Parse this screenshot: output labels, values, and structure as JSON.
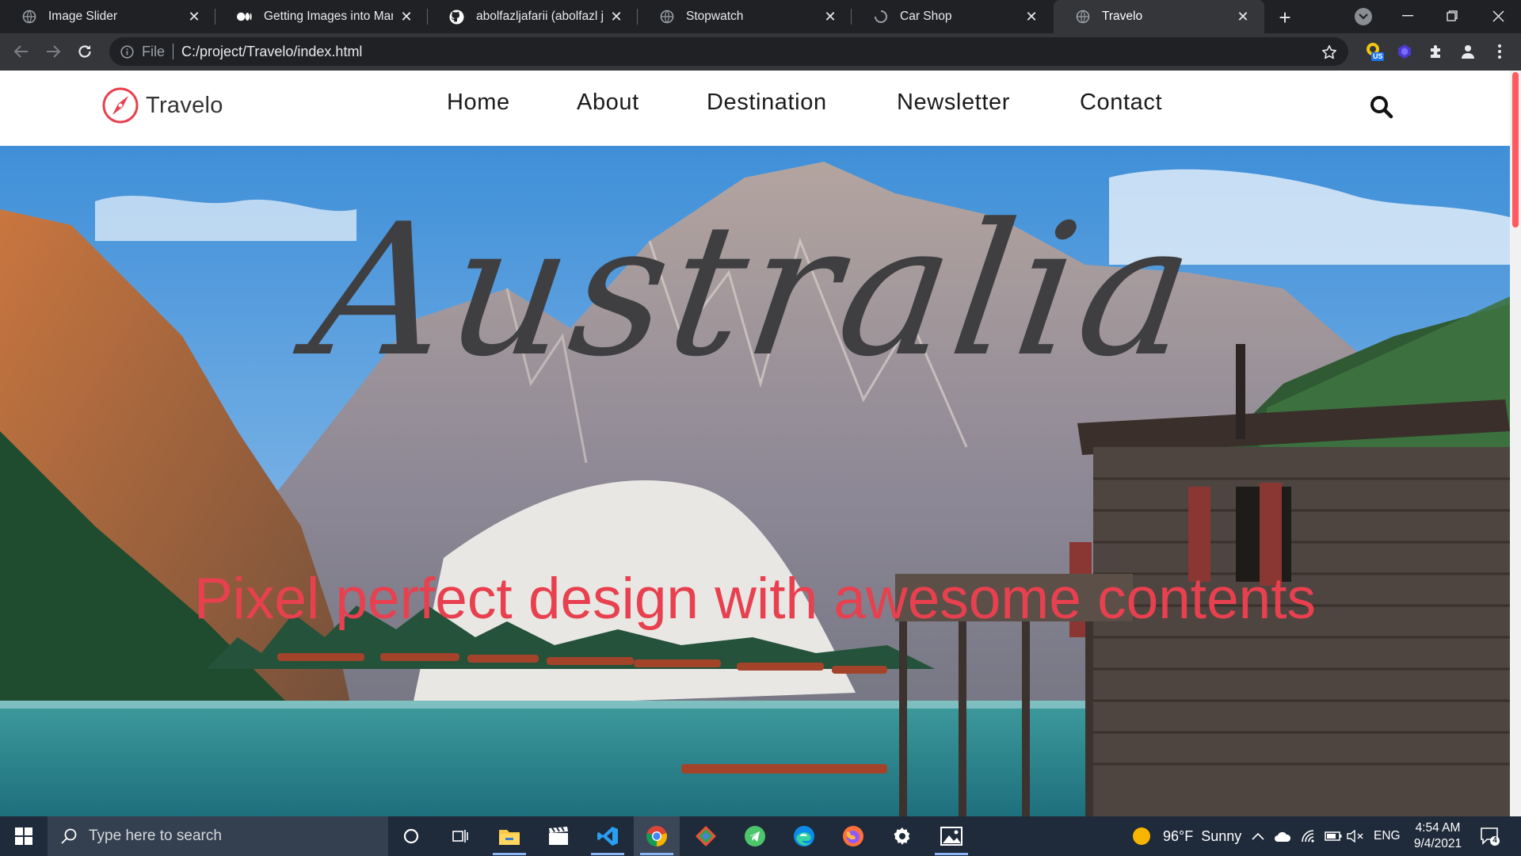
{
  "browser": {
    "tabs": [
      {
        "title": "Image Slider",
        "icon": "globe-icon",
        "active": false
      },
      {
        "title": "Getting Images into Markdo",
        "icon": "medium-icon",
        "active": false
      },
      {
        "title": "abolfazljafarii (abolfazl jafari",
        "icon": "github-icon",
        "active": false
      },
      {
        "title": "Stopwatch",
        "icon": "globe-icon",
        "active": false
      },
      {
        "title": "Car Shop",
        "icon": "loading-icon",
        "active": false
      },
      {
        "title": "Travelo",
        "icon": "globe-icon",
        "active": true
      }
    ],
    "address": {
      "scheme_label": "File",
      "url": "C:/project/Travelo/index.html"
    },
    "extension_badge": "US"
  },
  "site": {
    "logo_text": "Travelo",
    "nav": [
      "Home",
      "About",
      "Destination",
      "Newsletter",
      "Contact"
    ],
    "hero_title": "Australia",
    "hero_subtitle": "Pixel perfect design with awesome contents",
    "colors": {
      "accent": "#e8404f",
      "title": "#3f3f42"
    }
  },
  "taskbar": {
    "search_placeholder": "Type here to search",
    "weather": {
      "temp": "96°F",
      "condition": "Sunny"
    },
    "language": "ENG",
    "time": "4:54 AM",
    "date": "9/4/2021",
    "notification_count": "4",
    "apps": [
      "task-view-icon",
      "widgets-icon",
      "file-explorer-icon",
      "movie-maker-icon",
      "vscode-icon",
      "chrome-icon",
      "git-icon",
      "telegram-icon",
      "edge-icon",
      "firefox-icon",
      "settings-icon",
      "photos-icon"
    ]
  }
}
